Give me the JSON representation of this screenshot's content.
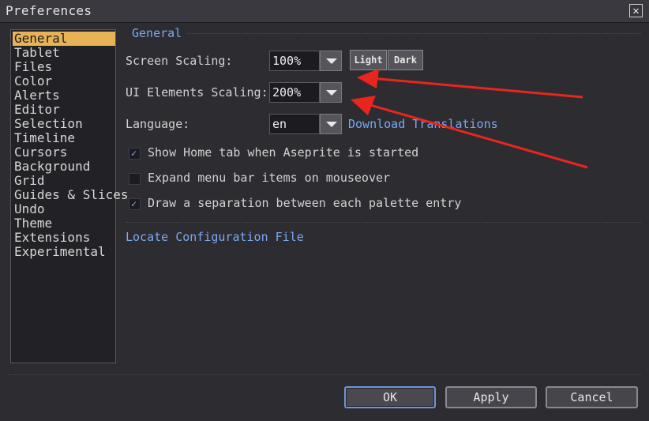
{
  "window": {
    "title": "Preferences",
    "close_icon": "✕"
  },
  "sidebar": {
    "items": [
      {
        "label": "General",
        "selected": true
      },
      {
        "label": "Tablet"
      },
      {
        "label": "Files"
      },
      {
        "label": "Color"
      },
      {
        "label": "Alerts"
      },
      {
        "label": "Editor"
      },
      {
        "label": "Selection"
      },
      {
        "label": "Timeline"
      },
      {
        "label": "Cursors"
      },
      {
        "label": "Background"
      },
      {
        "label": "Grid"
      },
      {
        "label": "Guides & Slices"
      },
      {
        "label": "Undo"
      },
      {
        "label": "Theme"
      },
      {
        "label": "Extensions"
      },
      {
        "label": "Experimental"
      }
    ]
  },
  "general": {
    "section_title": "General",
    "screen_scaling": {
      "label": "Screen Scaling:",
      "value": "100%"
    },
    "theme_buttons": {
      "light": "Light",
      "dark": "Dark"
    },
    "ui_scaling": {
      "label": "UI Elements Scaling:",
      "value": "200%"
    },
    "language": {
      "label": "Language:",
      "value": "en",
      "download_link": "Download Translations"
    },
    "options": [
      {
        "label": "Show Home tab when Aseprite is started",
        "checked": true
      },
      {
        "label": "Expand menu bar items on mouseover",
        "checked": false
      },
      {
        "label": "Draw a separation between each palette entry",
        "checked": true
      }
    ],
    "locate_config": "Locate Configuration File"
  },
  "footer": {
    "ok": "OK",
    "apply": "Apply",
    "cancel": "Cancel"
  },
  "colors": {
    "accent": "#7aaaf0",
    "selection": "#e8b356",
    "arrow": "#e8261e"
  }
}
